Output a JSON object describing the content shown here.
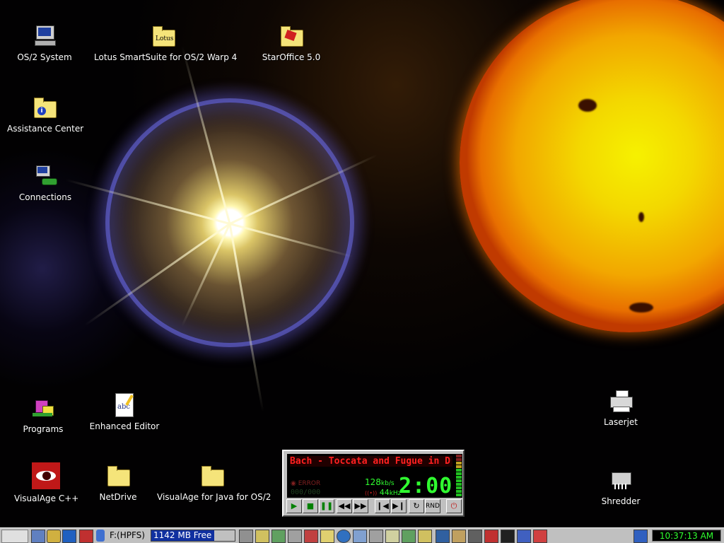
{
  "desktop": {
    "icons": [
      {
        "label": "OS/2 System"
      },
      {
        "label": "Lotus SmartSuite for OS/2 Warp 4",
        "badge": "Lotus"
      },
      {
        "label": "StarOffice 5.0"
      },
      {
        "label": "Assistance Center"
      },
      {
        "label": "Connections"
      },
      {
        "label": "Programs"
      },
      {
        "label": "Enhanced Editor",
        "badge": "abc"
      },
      {
        "label": "VisualAge C++"
      },
      {
        "label": "NetDrive"
      },
      {
        "label": "VisualAge for Java for OS/2"
      },
      {
        "label": "Laserjet"
      },
      {
        "label": "Shredder"
      }
    ]
  },
  "player": {
    "song": "Bach - Toccata and Fugue in D",
    "error_label": "ERROR",
    "counter": "000/000",
    "bitrate": "128",
    "bitrate_unit": "kb/s",
    "samplerate": "44",
    "samplerate_unit": "kHz",
    "time": "2:00",
    "buttons": [
      "play",
      "stop",
      "pause",
      "rewind",
      "fast-forward",
      "previous",
      "next",
      "repeat",
      "RND",
      "power"
    ]
  },
  "taskbar": {
    "drive": "F:(HPFS)",
    "free_space": "1142 MB Free",
    "free_fraction": 0.75,
    "clock": "10:37:13 AM"
  },
  "colors": {
    "lcd_red": "#ff2020",
    "lcd_green": "#30ff30",
    "panel_gray": "#c0c0c0"
  }
}
